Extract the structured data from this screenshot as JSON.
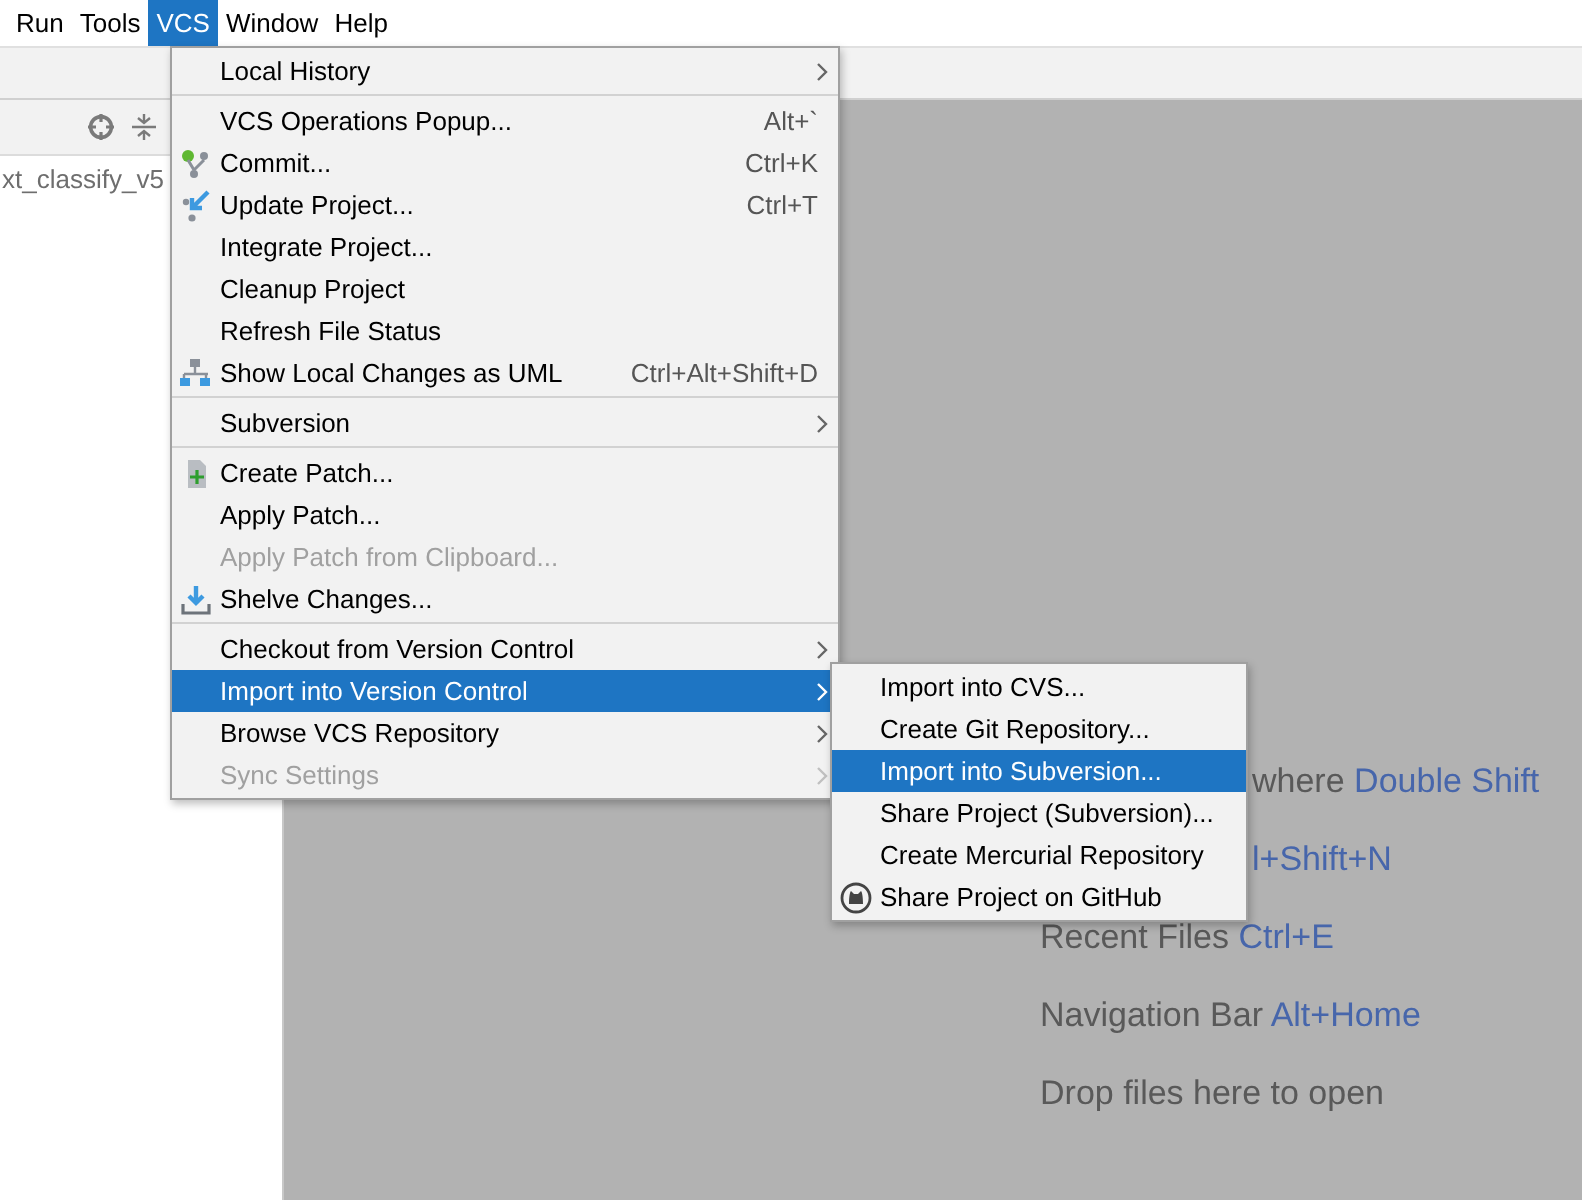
{
  "menubar": [
    {
      "label": "Run",
      "selected": false
    },
    {
      "label": "Tools",
      "selected": false
    },
    {
      "label": "VCS",
      "selected": true
    },
    {
      "label": "Window",
      "selected": false
    },
    {
      "label": "Help",
      "selected": false
    }
  ],
  "project_panel": {
    "root_label": "xt_classify_v5"
  },
  "vcs_menu": {
    "sections": [
      {
        "items": [
          {
            "kind": "plain",
            "label": "Local History",
            "submenu": true,
            "disabled": false,
            "selected": false
          }
        ]
      },
      {
        "items": [
          {
            "kind": "plain",
            "label": "VCS Operations Popup...",
            "shortcut": "Alt+`",
            "submenu": false,
            "disabled": false,
            "selected": false
          },
          {
            "kind": "commit",
            "label": "Commit...",
            "shortcut": "Ctrl+K",
            "submenu": false,
            "disabled": false,
            "selected": false
          },
          {
            "kind": "update",
            "label": "Update Project...",
            "shortcut": "Ctrl+T",
            "submenu": false,
            "disabled": false,
            "selected": false
          },
          {
            "kind": "plain",
            "label": "Integrate Project...",
            "submenu": false,
            "disabled": false,
            "selected": false
          },
          {
            "kind": "plain",
            "label": "Cleanup Project",
            "submenu": false,
            "disabled": false,
            "selected": false
          },
          {
            "kind": "plain",
            "label": "Refresh File Status",
            "submenu": false,
            "disabled": false,
            "selected": false
          },
          {
            "kind": "uml",
            "label": "Show Local Changes as UML",
            "shortcut": "Ctrl+Alt+Shift+D",
            "submenu": false,
            "disabled": false,
            "selected": false
          }
        ]
      },
      {
        "items": [
          {
            "kind": "plain",
            "label": "Subversion",
            "submenu": true,
            "disabled": false,
            "selected": false
          }
        ]
      },
      {
        "items": [
          {
            "kind": "patch",
            "label": "Create Patch...",
            "submenu": false,
            "disabled": false,
            "selected": false
          },
          {
            "kind": "plain",
            "label": "Apply Patch...",
            "submenu": false,
            "disabled": false,
            "selected": false
          },
          {
            "kind": "plain",
            "label": "Apply Patch from Clipboard...",
            "submenu": false,
            "disabled": true,
            "selected": false
          },
          {
            "kind": "shelve",
            "label": "Shelve Changes...",
            "submenu": false,
            "disabled": false,
            "selected": false
          }
        ]
      },
      {
        "items": [
          {
            "kind": "plain",
            "label": "Checkout from Version Control",
            "submenu": true,
            "disabled": false,
            "selected": false
          },
          {
            "kind": "plain",
            "label": "Import into Version Control",
            "submenu": true,
            "disabled": false,
            "selected": true
          },
          {
            "kind": "plain",
            "label": "Browse VCS Repository",
            "submenu": true,
            "disabled": false,
            "selected": false
          },
          {
            "kind": "plain",
            "label": "Sync Settings",
            "submenu": true,
            "disabled": true,
            "selected": false
          }
        ]
      }
    ]
  },
  "import_submenu": {
    "items": [
      {
        "kind": "plain",
        "label": "Import into CVS...",
        "selected": false
      },
      {
        "kind": "plain",
        "label": "Create Git Repository...",
        "selected": false
      },
      {
        "kind": "plain",
        "label": "Import into Subversion...",
        "selected": true
      },
      {
        "kind": "plain",
        "label": "Share Project (Subversion)...",
        "selected": false
      },
      {
        "kind": "plain",
        "label": "Create Mercurial Repository",
        "selected": false
      },
      {
        "kind": "github",
        "label": "Share Project on GitHub",
        "selected": false
      }
    ]
  },
  "editor_hints": [
    {
      "kind": "clipped",
      "action": "where",
      "shortcut": "Double Shift"
    },
    {
      "kind": "clipped",
      "shortcut": "l+Shift+N"
    },
    {
      "kind": "full",
      "action": "Recent Files",
      "shortcut": "Ctrl+E"
    },
    {
      "kind": "full",
      "action": "Navigation Bar",
      "shortcut": "Alt+Home"
    },
    {
      "kind": "full",
      "action": "Drop files here to open"
    }
  ]
}
